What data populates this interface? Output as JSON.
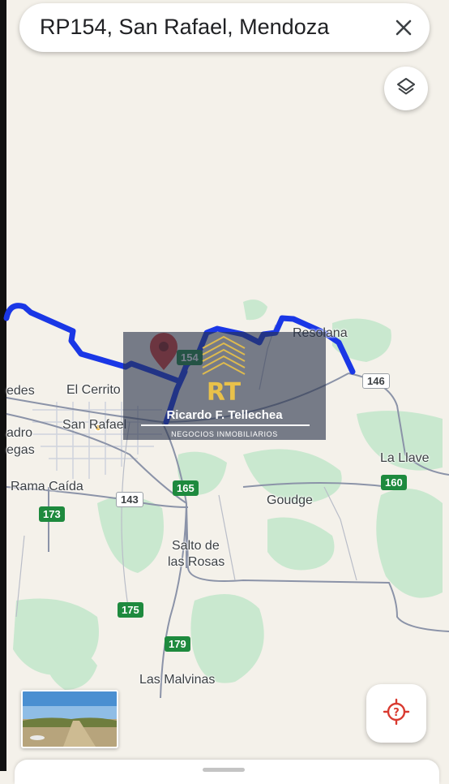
{
  "search": {
    "query": "RP154, San Rafael, Mendoza"
  },
  "icons": {
    "close": "close-icon",
    "layers": "layers-icon",
    "pin": "map-pin-icon",
    "locate": "my-location-icon"
  },
  "places": {
    "resolana": "Resolana",
    "el_cerrito": "El Cerrito",
    "edes": "edes",
    "san_rafael": "San Rafael",
    "adro": "adro",
    "egas": "egas",
    "la_llave": "La Llave",
    "rama_caida": "Rama Caída",
    "goudge": "Goudge",
    "salto_line1": "Salto de",
    "salto_line2": "las Rosas",
    "las_malvinas": "Las Malvinas"
  },
  "routes": {
    "r154": "154",
    "r146": "146",
    "r165": "165",
    "r143": "143",
    "r160": "160",
    "r173": "173",
    "r175": "175",
    "r179": "179"
  },
  "watermark": {
    "name": "Ricardo F. Tellechea",
    "subtitle": "NEGOCIOS INMOBILIARIOS",
    "logo_letters": "RT"
  },
  "colors": {
    "route_blue": "#1a37e6",
    "road_gray": "#8b93a8",
    "park_green": "#c9e8cf",
    "shield_green": "#1e8a3e",
    "pin_red": "#d93a30"
  }
}
